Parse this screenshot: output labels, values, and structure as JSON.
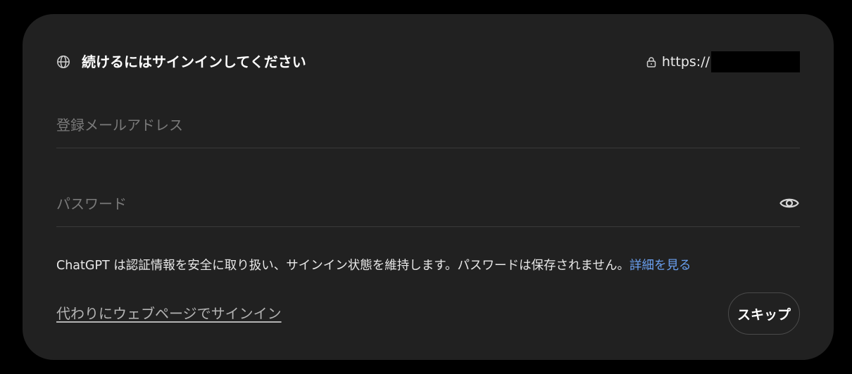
{
  "dialog": {
    "title": "続けるにはサインインしてください",
    "url": "https://",
    "icons": {
      "header": "globe-icon",
      "url": "lock-icon",
      "password_toggle": "eye-icon"
    }
  },
  "form": {
    "email_placeholder": "登録メールアドレス",
    "email_value": "",
    "password_placeholder": "パスワード",
    "password_value": ""
  },
  "notice": {
    "text": "ChatGPT は認証情報を安全に取り扱い、サインイン状態を維持します。パスワードは保存されません。",
    "link": "詳細を見る"
  },
  "footer": {
    "web_signin_link": "代わりにウェブページでサインイン",
    "skip_label": "スキップ"
  },
  "colors": {
    "background": "#000000",
    "dialog": "#212121",
    "link": "#6aa0f0",
    "divider": "#3a3a3a"
  }
}
